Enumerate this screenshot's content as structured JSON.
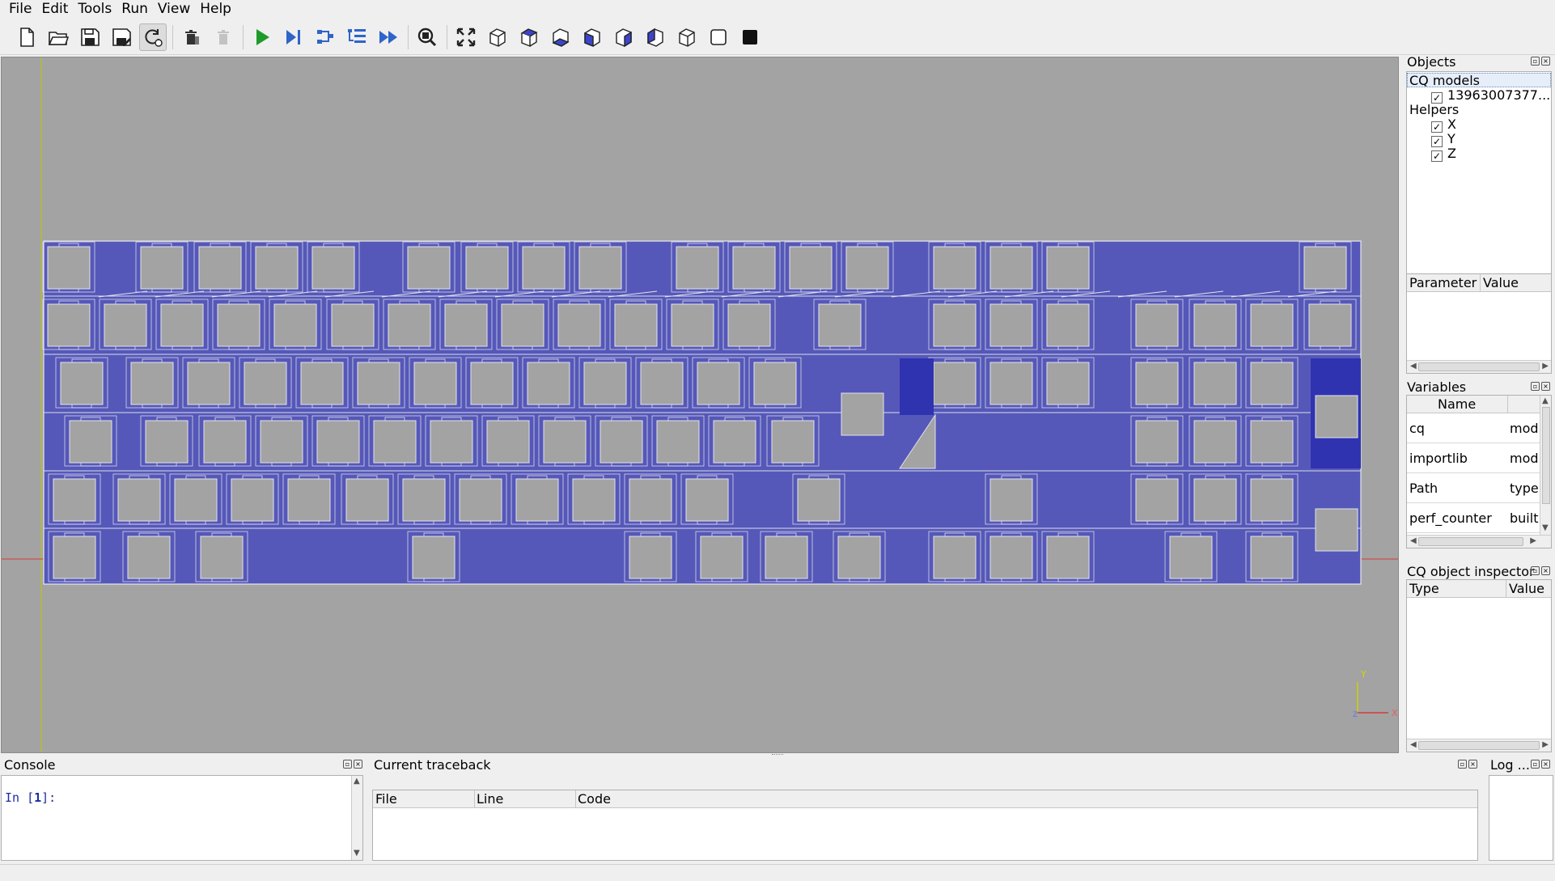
{
  "menu": [
    "File",
    "Edit",
    "Tools",
    "Run",
    "View",
    "Help"
  ],
  "toolbar": {
    "buttons": [
      "new-file",
      "open-file",
      "save",
      "save-as",
      "autoreload",
      "clear-stack",
      "delete",
      "run",
      "debug",
      "step-over",
      "step-in",
      "continue",
      "zoom-fit-search",
      "fit-all",
      "iso-view",
      "top-view",
      "bottom-view",
      "front-view",
      "back-view",
      "left-view",
      "right-view",
      "wireframe",
      "shaded"
    ]
  },
  "objects": {
    "title": "Objects",
    "group_cq": "CQ models",
    "model": "13963007377...",
    "group_helpers": "Helpers",
    "helpers": [
      "X",
      "Y",
      "Z"
    ]
  },
  "params": {
    "col1": "Parameter",
    "col2": "Value"
  },
  "variables": {
    "title": "Variables",
    "col_name": "Name",
    "rows": [
      {
        "name": "cq",
        "value": "modu"
      },
      {
        "name": "importlib",
        "value": "modu"
      },
      {
        "name": "Path",
        "value": "type"
      },
      {
        "name": "perf_counter",
        "value": "builti"
      }
    ]
  },
  "inspector": {
    "title": "CQ object inspector",
    "col1": "Type",
    "col2": "Value"
  },
  "console": {
    "title": "Console",
    "prompt_prefix": "In [",
    "prompt_num": "1",
    "prompt_suffix": "]:"
  },
  "traceback": {
    "title": "Current traceback",
    "col_file": "File",
    "col_line": "Line",
    "col_code": "Code"
  },
  "log": {
    "title": "Log ..."
  },
  "axes": {
    "x": "X",
    "y": "Y",
    "z": "Z"
  },
  "colors": {
    "model_fill": "#5558b8",
    "model_dark": "#2f33b0",
    "cutout": "#a3a3a3",
    "viewport_bg": "#a3a3a3"
  }
}
